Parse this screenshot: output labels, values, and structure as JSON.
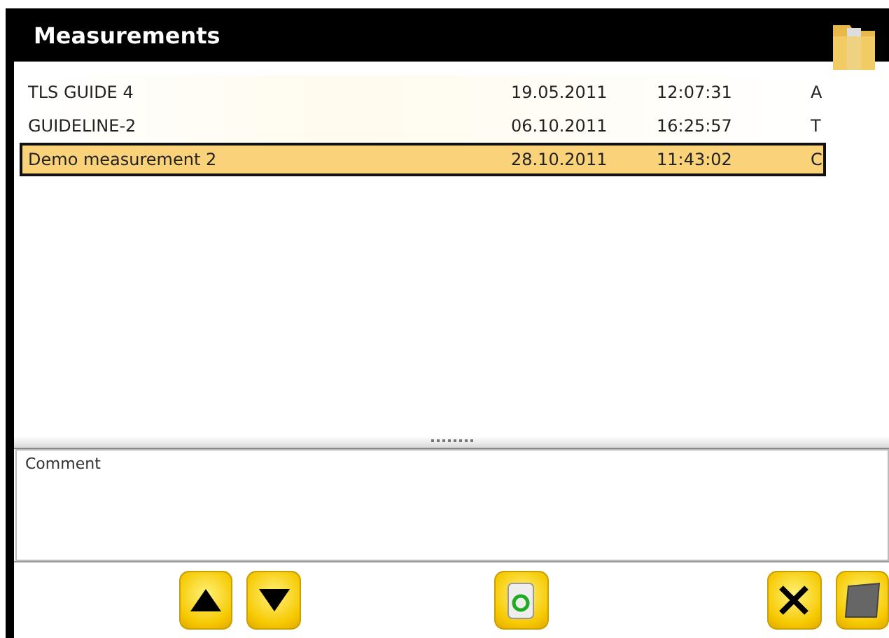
{
  "window": {
    "title": "Measurements"
  },
  "measurements": [
    {
      "name": "TLS GUIDE 4",
      "date": "19.05.2011",
      "time": "12:07:31",
      "type": "A",
      "selected": false
    },
    {
      "name": "GUIDELINE-2",
      "date": "06.10.2011",
      "time": "16:25:57",
      "type": "T",
      "selected": false
    },
    {
      "name": "Demo measurement 2",
      "date": "28.10.2011",
      "time": "11:43:02",
      "type": "C",
      "selected": true
    }
  ],
  "comment": {
    "placeholder": "Comment"
  },
  "toolbar": [
    {
      "kind": "up"
    },
    {
      "kind": "down"
    },
    {
      "kind": "gap"
    },
    {
      "kind": "recycle"
    },
    {
      "kind": "gap"
    },
    {
      "kind": "close"
    },
    {
      "kind": "book"
    }
  ]
}
